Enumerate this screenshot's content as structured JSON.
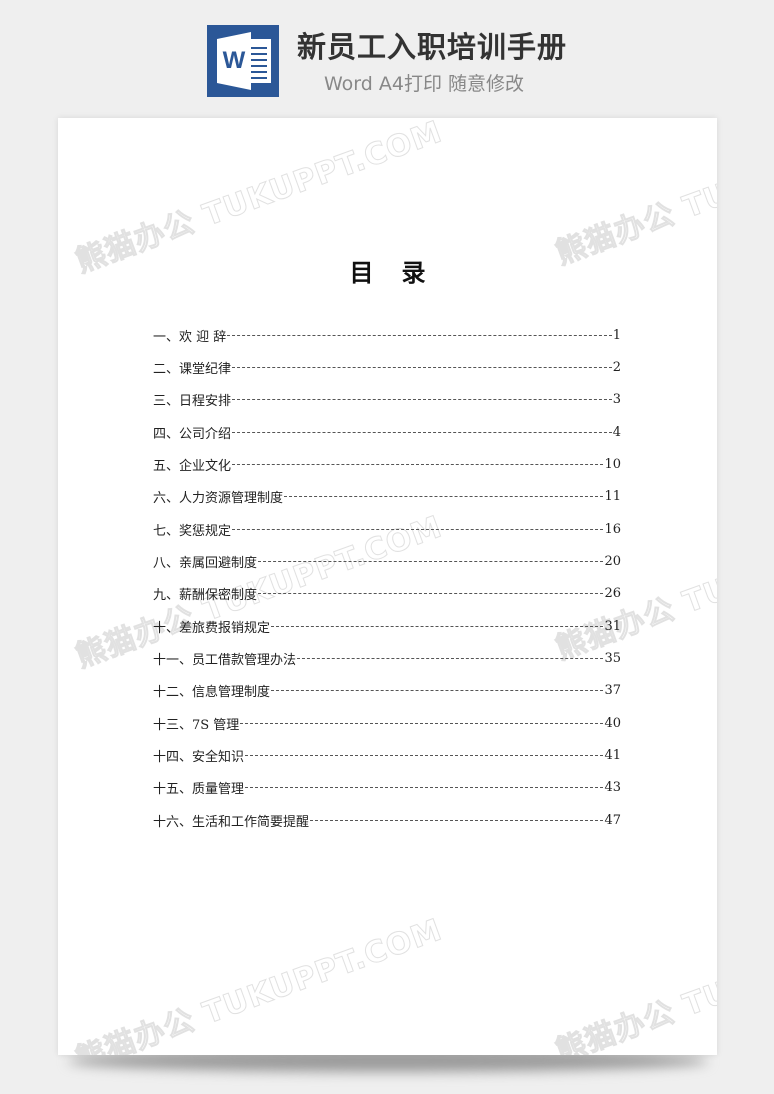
{
  "header": {
    "icon": "word-document-icon",
    "icon_letter": "W",
    "title": "新员工入职培训手册",
    "subtitle": "Word A4打印 随意修改",
    "brand_color": "#2b5797"
  },
  "document": {
    "toc_title_chars": [
      "目",
      "录"
    ],
    "watermark": "熊猫办公 TUKUPPT.COM",
    "toc": [
      {
        "label": "一、欢 迎 辞",
        "page": "1"
      },
      {
        "label": "二、课堂纪律",
        "page": "2"
      },
      {
        "label": "三、日程安排",
        "page": "3"
      },
      {
        "label": "四、公司介绍",
        "page": "4"
      },
      {
        "label": "五、企业文化",
        "page": "10"
      },
      {
        "label": "六、人力资源管理制度",
        "page": "11"
      },
      {
        "label": "七、奖惩规定",
        "page": "16"
      },
      {
        "label": "八、亲属回避制度",
        "page": "20"
      },
      {
        "label": "九、薪酬保密制度",
        "page": "26"
      },
      {
        "label": "十、差旅费报销规定",
        "page": "31"
      },
      {
        "label": "十一、员工借款管理办法",
        "page": "35"
      },
      {
        "label": "十二、信息管理制度",
        "page": "37"
      },
      {
        "label": "十三、7S 管理 ",
        "page": "40"
      },
      {
        "label": "十四、安全知识",
        "page": "41"
      },
      {
        "label": "十五、质量管理",
        "page": "43"
      },
      {
        "label": "十六、生活和工作简要提醒",
        "page": "47"
      }
    ]
  }
}
